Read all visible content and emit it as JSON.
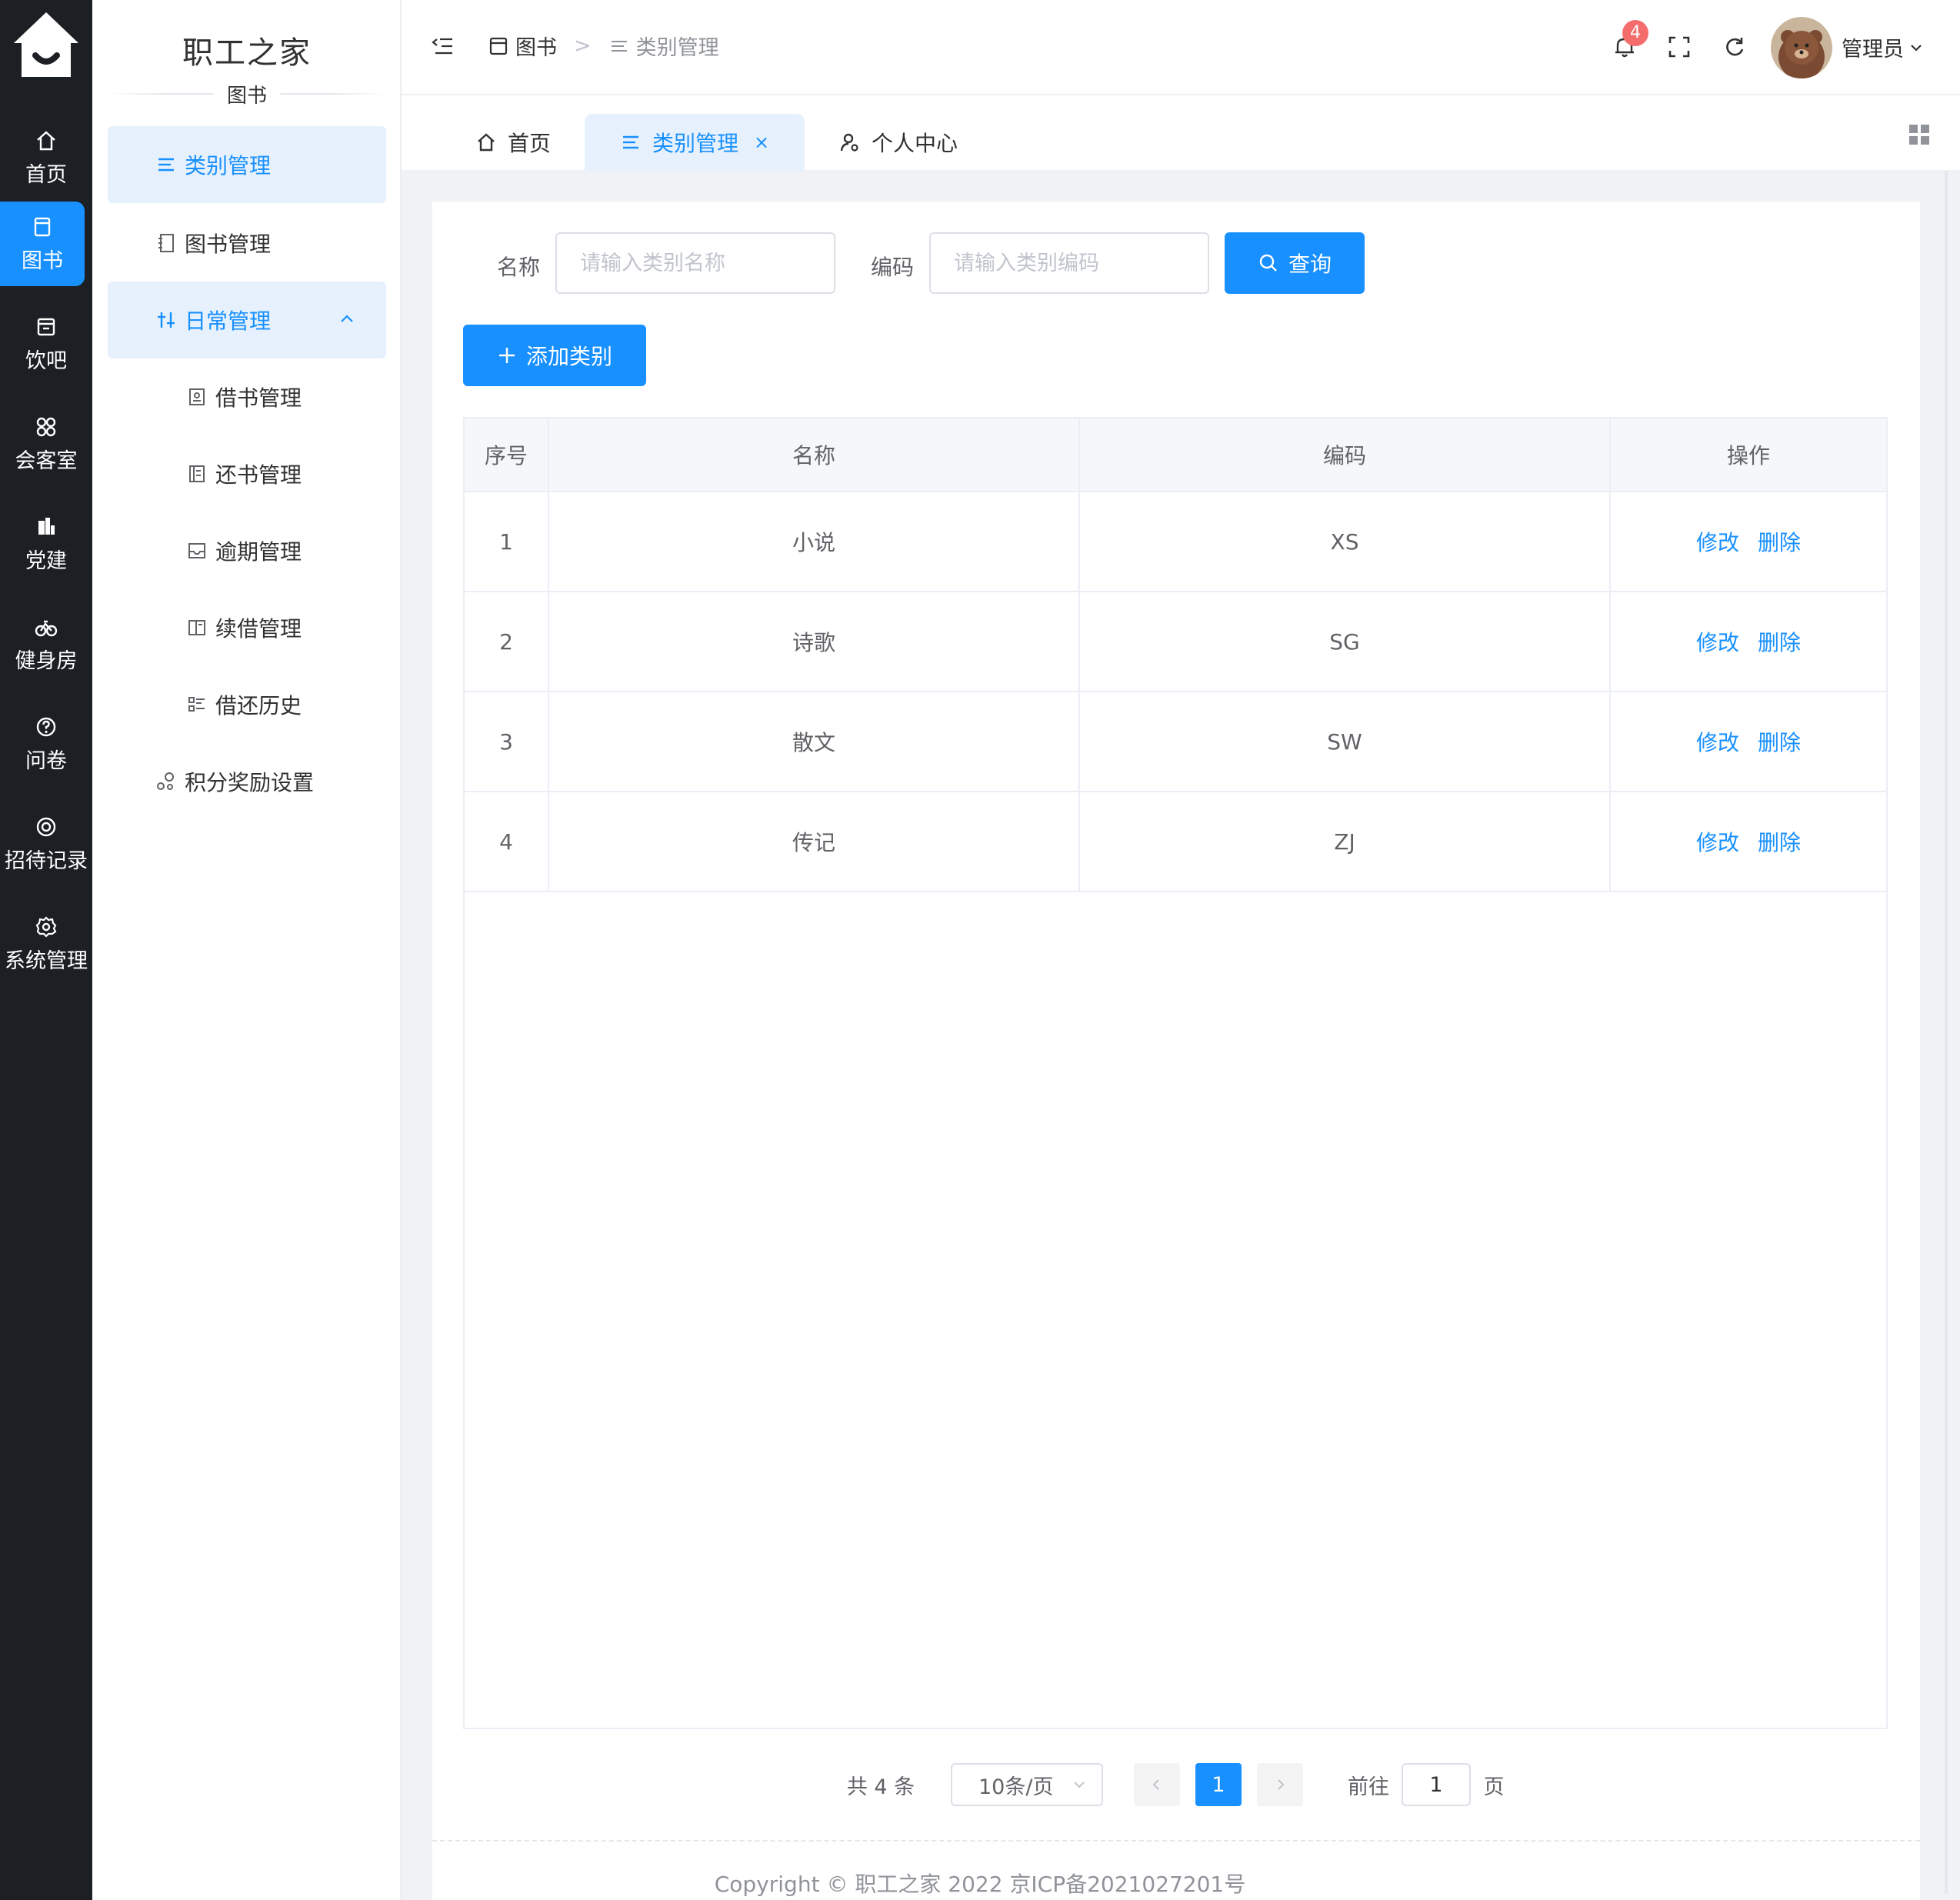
{
  "brand": {
    "title": "职工之家",
    "subtitle": "图书"
  },
  "rail": {
    "items": [
      {
        "label": "首页",
        "icon": "home-icon"
      },
      {
        "label": "图书",
        "icon": "book-icon",
        "active": true
      },
      {
        "label": "饮吧",
        "icon": "cafe-icon"
      },
      {
        "label": "会客室",
        "icon": "grid-icon"
      },
      {
        "label": "党建",
        "icon": "building-icon"
      },
      {
        "label": "健身房",
        "icon": "bike-icon"
      },
      {
        "label": "问卷",
        "icon": "question-icon"
      },
      {
        "label": "招待记录",
        "icon": "target-icon"
      },
      {
        "label": "系统管理",
        "icon": "gear-icon"
      }
    ]
  },
  "sidebar": {
    "items": [
      {
        "label": "类别管理",
        "icon": "list-icon"
      },
      {
        "label": "图书管理",
        "icon": "notebook-icon"
      },
      {
        "label": "日常管理",
        "icon": "sliders-icon"
      },
      {
        "label": "借书管理",
        "icon": "id-card-icon"
      },
      {
        "label": "还书管理",
        "icon": "return-book-icon"
      },
      {
        "label": "逾期管理",
        "icon": "tray-icon"
      },
      {
        "label": "续借管理",
        "icon": "renew-icon"
      },
      {
        "label": "借还历史",
        "icon": "history-list-icon"
      },
      {
        "label": "积分奖励设置",
        "icon": "points-icon"
      }
    ]
  },
  "header": {
    "breadcrumb": [
      "图书",
      "类别管理"
    ],
    "breadcrumb_sep": ">",
    "notification_count": "4",
    "user_name": "管理员"
  },
  "tabs": [
    {
      "label": "首页",
      "icon": "home-icon"
    },
    {
      "label": "类别管理",
      "icon": "list-icon",
      "active": true,
      "close": "×"
    },
    {
      "label": "个人中心",
      "icon": "user-gear-icon"
    }
  ],
  "search": {
    "name_label": "名称",
    "name_placeholder": "请输入类别名称",
    "code_label": "编码",
    "code_placeholder": "请输入类别编码",
    "query_button": "查询",
    "add_button": "添加类别"
  },
  "table": {
    "columns": [
      "序号",
      "名称",
      "编码",
      "操作"
    ],
    "rows": [
      {
        "index": "1",
        "name": "小说",
        "code": "XS"
      },
      {
        "index": "2",
        "name": "诗歌",
        "code": "SG"
      },
      {
        "index": "3",
        "name": "散文",
        "code": "SW"
      },
      {
        "index": "4",
        "name": "传记",
        "code": "ZJ"
      }
    ],
    "edit_label": "修改",
    "delete_label": "删除"
  },
  "pagination": {
    "total": "共 4 条",
    "page_size": "10条/页",
    "current_page": "1",
    "goto_label": "前往",
    "goto_value": "1",
    "page_suffix": "页"
  },
  "footer": {
    "copyright": "Copyright © 职工之家 2022 京ICP备2021027201号"
  },
  "colors": {
    "primary": "#1890ff",
    "rail_bg": "#1c1f24",
    "badge": "#f56c6c"
  }
}
